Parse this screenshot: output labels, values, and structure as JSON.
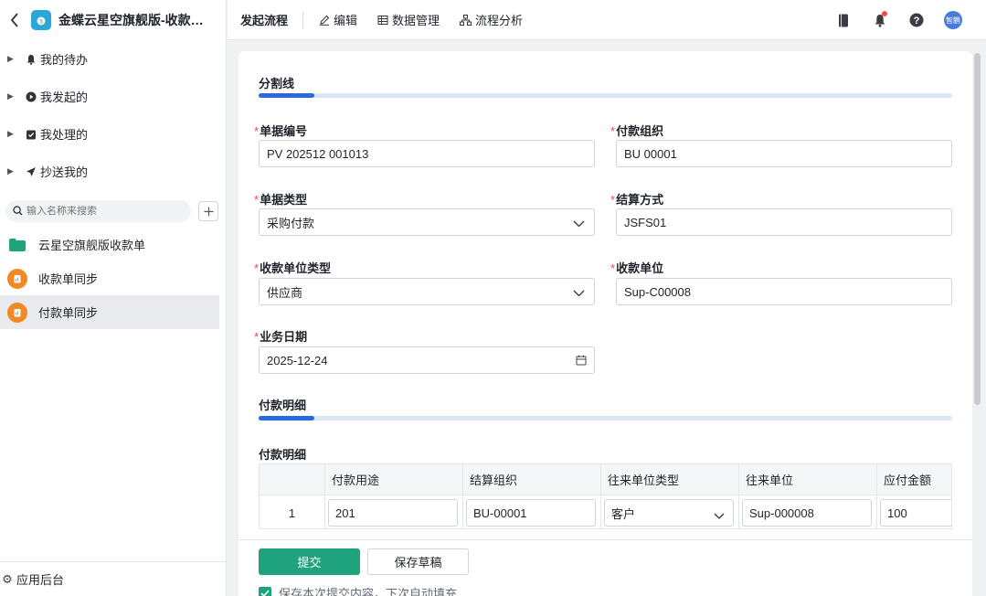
{
  "sidebar": {
    "app_title": "金蝶云星空旗舰版-收款单...",
    "nav": [
      {
        "label": "我的待办",
        "icon": "bell-icon"
      },
      {
        "label": "我发起的",
        "icon": "play-circle-icon"
      },
      {
        "label": "我处理的",
        "icon": "check-square-icon"
      },
      {
        "label": "抄送我的",
        "icon": "send-icon"
      }
    ],
    "search_placeholder": "输入名称来搜索",
    "forms": [
      {
        "label": "云星空旗舰版收款单",
        "icon": "folder-icon"
      },
      {
        "label": "收款单同步",
        "icon": "form-icon"
      },
      {
        "label": "付款单同步",
        "icon": "form-icon"
      }
    ],
    "footer": "应用后台"
  },
  "topbar": {
    "tabs": [
      {
        "label": "发起流程",
        "icon": ""
      },
      {
        "label": "编辑",
        "icon": "edit-icon"
      },
      {
        "label": "数据管理",
        "icon": "table-icon"
      },
      {
        "label": "流程分析",
        "icon": "flow-icon"
      }
    ],
    "avatar_text": "智鹏"
  },
  "form": {
    "section1": "分割线",
    "fields": {
      "bill_no": {
        "label": "单据编号",
        "value": "PV 202512 001013"
      },
      "pay_org": {
        "label": "付款组织",
        "value": "BU 00001"
      },
      "bill_type": {
        "label": "单据类型",
        "value": "采购付款"
      },
      "settle_mode": {
        "label": "结算方式",
        "value": "JSFS01"
      },
      "payee_type": {
        "label": "收款单位类型",
        "value": "供应商"
      },
      "payee": {
        "label": "收款单位",
        "value": "Sup-C00008"
      },
      "biz_date": {
        "label": "业务日期",
        "value": "2025-12-24"
      }
    },
    "section2": "付款明细",
    "detail_label": "付款明细",
    "table": {
      "headers": [
        "",
        "付款用途",
        "结算组织",
        "往来单位类型",
        "往来单位",
        "应付金额"
      ],
      "row": {
        "index": "1",
        "purpose": "201",
        "org": "BU-00001",
        "partner_type": "客户",
        "partner": "Sup-000008",
        "amount": "100"
      }
    },
    "submit": "提交",
    "save_draft": "保存草稿",
    "remember": "保存本次提交内容，下次自动填充"
  }
}
